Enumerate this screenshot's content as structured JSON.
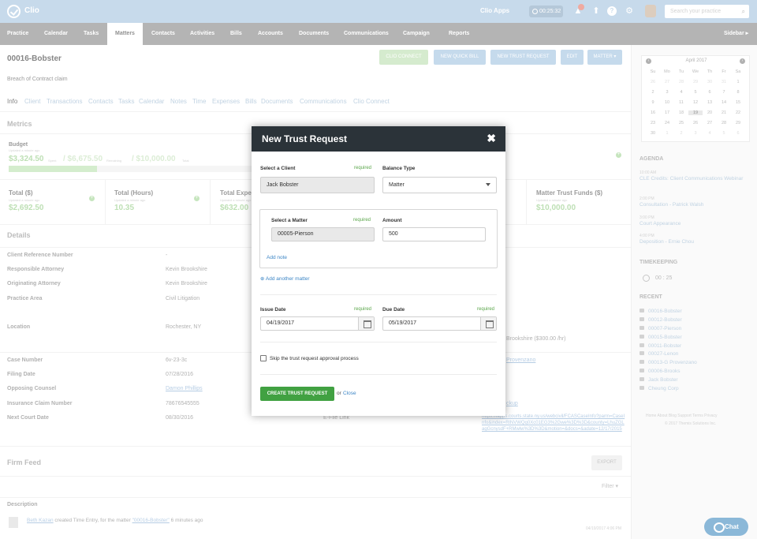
{
  "topbar": {
    "logo": "Clio",
    "apps": "Clio Apps",
    "timer": "00:25:32",
    "search_placeholder": "Search your practice"
  },
  "nav": {
    "items": [
      "Practice",
      "Calendar",
      "Tasks",
      "Matters",
      "Contacts",
      "Activities",
      "Bills",
      "Accounts",
      "Documents",
      "Communications",
      "Campaign",
      "Reports"
    ],
    "active": "Matters",
    "sidebar_toggle": "Sidebar ▸"
  },
  "matter": {
    "title": "00016-Bobster",
    "subtitle": "Breach of Contract claim"
  },
  "actions": {
    "clio_connect": "CLIO CONNECT",
    "quick_bill": "NEW QUICK BILL",
    "trust_request": "NEW TRUST REQUEST",
    "edit": "EDIT",
    "matter": "MATTER ▾"
  },
  "tabs": [
    "Info",
    "Client",
    "Transactions",
    "Contacts",
    "Tasks",
    "Calendar",
    "Notes",
    "Time",
    "Expenses",
    "Bills",
    "Documents",
    "Communications",
    "Clio Connect"
  ],
  "metrics": {
    "heading": "Metrics",
    "budget_label": "Budget",
    "budget_updated": "Updated a minute ago",
    "budget_spent": "$3,324.50",
    "spent_label": "Spent",
    "budget_mid": "/ $6,675.50",
    "remaining_label": "Remaining",
    "budget_total": "/ $10,000.00",
    "total_label": "Total",
    "budget_fraction": 0.33,
    "total_dollars_label": "Total ($)",
    "total_dollars_updated": "Updated a minute ago",
    "total_dollars": "$2,692.50",
    "total_hours_label": "Total (Hours)",
    "total_hours_updated": "Updated a minute ago",
    "total_hours": "10.35",
    "total_exp_label": "Total Expe",
    "total_exp_updated": "Updated a minute ago",
    "total_exp": "$632.00",
    "trust_label": "Matter Trust Funds ($)",
    "trust_updated": "Updated a minute ago",
    "trust_value": "$10,000.00"
  },
  "details": {
    "heading": "Details",
    "rows": [
      {
        "label": "Client Reference Number",
        "value": "-"
      },
      {
        "label": "Responsible Attorney",
        "value": "Kevin Brookshire"
      },
      {
        "label": "Originating Attorney",
        "value": "Kevin Brookshire"
      },
      {
        "label": "Practice Area",
        "value": "Civil Litigation"
      },
      {
        "label": "Location",
        "value": "Rochester, NY"
      },
      {
        "label": "Case Number",
        "value": "6v-23-3c"
      },
      {
        "label": "Filing Date",
        "value": "07/28/2016"
      },
      {
        "label": "Opposing Counsel",
        "value": "Damon Phillips"
      },
      {
        "label": "Insurance Claim Number",
        "value": "78676545555"
      },
      {
        "label": "Next Court Date",
        "value": "08/30/2016"
      }
    ],
    "efile_label": "E-File Link",
    "right_bits": [
      "Brookshire ($300.00 /hr)",
      "Provenzano",
      "ckup"
    ],
    "efile_url": "https://iapps.courts.state.ny.us/webcivil/FCASCaseInfo?parm=CaseInfo&index=RlNVWQq0Xc01EG3%2Gwe%3D%3D&county=LhuZGLagGcnysdF+RMwlw%3D%3D&motion=&docs=&adate=12/17/2015"
  },
  "feed": {
    "heading": "Firm Feed",
    "export": "EXPORT",
    "filter": "Filter ▾",
    "desc_heading": "Description",
    "entry_user": "Beth Kazan",
    "entry_text": "created Time Entry, for the matter",
    "entry_matter": "\"00016-Bobster\"",
    "entry_time": "6 minutes ago",
    "entry_timestamp": "04/19/2017 4:06 PM"
  },
  "modal": {
    "title": "New Trust Request",
    "close": "✖",
    "client_label": "Select a Client",
    "required": "required",
    "client_value": "Jack Bobster",
    "balance_label": "Balance Type",
    "balance_value": "Matter",
    "matter_label": "Select a Matter",
    "matter_value": "00005-Pierson",
    "amount_label": "Amount",
    "amount_value": "500",
    "add_note": "Add note",
    "add_matter": "Add another matter",
    "issue_label": "Issue Date",
    "issue_value": "04/19/2017",
    "due_label": "Due Date",
    "due_value": "05/19/2017",
    "skip_label": "Skip the trust request approval process",
    "create": "CREATE TRUST REQUEST",
    "or": "or",
    "close_link": "Close"
  },
  "calendar": {
    "month": "April 2017",
    "days": [
      "Su",
      "Mo",
      "Tu",
      "We",
      "Th",
      "Fr",
      "Sa"
    ],
    "weeks": [
      [
        "26",
        "27",
        "28",
        "29",
        "30",
        "31",
        "1"
      ],
      [
        "2",
        "3",
        "4",
        "5",
        "6",
        "7",
        "8"
      ],
      [
        "9",
        "10",
        "11",
        "12",
        "13",
        "14",
        "15"
      ],
      [
        "16",
        "17",
        "18",
        "19",
        "20",
        "21",
        "22"
      ],
      [
        "23",
        "24",
        "25",
        "26",
        "27",
        "28",
        "29"
      ],
      [
        "30",
        "1",
        "2",
        "3",
        "4",
        "5",
        "6"
      ]
    ],
    "today": "19"
  },
  "agenda": {
    "heading": "AGENDA",
    "items": [
      {
        "time": "10:00 AM",
        "title": "CLE Credits: Client Communications Webinar"
      },
      {
        "time": "2:00 PM",
        "title": "Consultation - Patrick Walsh"
      },
      {
        "time": "3:00 PM",
        "title": "Court Appearance"
      },
      {
        "time": "4:00 PM",
        "title": "Deposition - Ernie Chou"
      }
    ]
  },
  "timekeeping": {
    "heading": "TIMEKEEPING",
    "value": "00 : 25"
  },
  "recent": {
    "heading": "RECENT",
    "items": [
      "00016-Bobster",
      "00012-Bobster",
      "00007-Pierson",
      "00015-Bobster",
      "00011-Bobster",
      "00027-Lenon",
      "00013-G Provenzano",
      "00006-Brooks",
      "Jack Bobster",
      "Cheung Corp"
    ]
  },
  "footer": {
    "links": "Home  About  Blog  Support  Terms  Privacy",
    "copyright": "© 2017 Themis Solutions Inc."
  },
  "chat": "Chat"
}
